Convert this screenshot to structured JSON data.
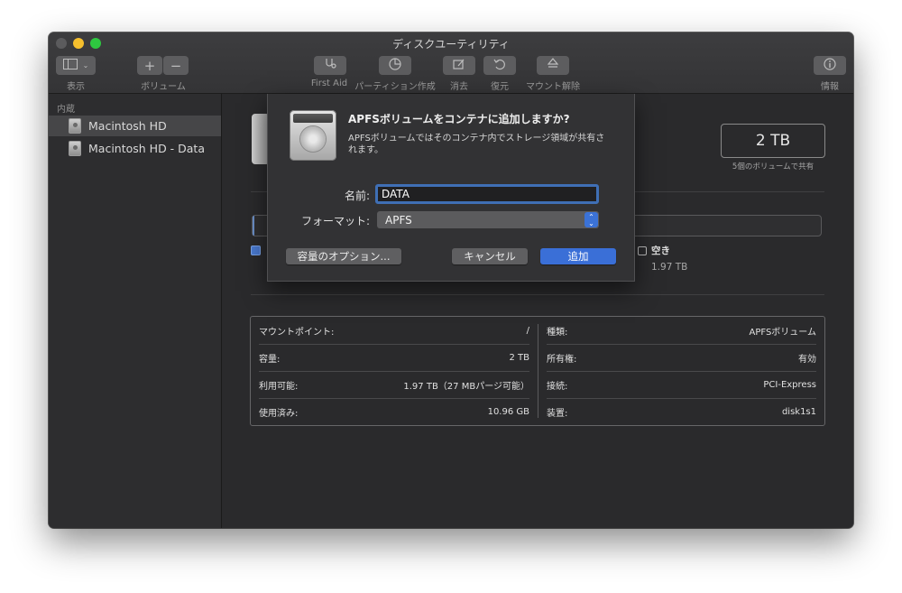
{
  "window": {
    "title": "ディスクユーティリティ"
  },
  "toolbar": {
    "view_label": "表示",
    "volume_label": "ボリューム",
    "first_aid_label": "First Aid",
    "partition_label": "パーティション作成",
    "erase_label": "消去",
    "restore_label": "復元",
    "unmount_label": "マウント解除",
    "info_label": "情報"
  },
  "sidebar": {
    "section": "内蔵",
    "items": [
      {
        "label": "Macintosh HD"
      },
      {
        "label": "Macintosh HD - Data"
      }
    ]
  },
  "main": {
    "capacity": "2 TB",
    "capacity_note": "5個のボリュームで共有",
    "free_label": "空き",
    "free_value": "1.97 TB"
  },
  "info": {
    "left": [
      {
        "label": "マウントポイント:",
        "value": "/"
      },
      {
        "label": "容量:",
        "value": "2 TB"
      },
      {
        "label": "利用可能:",
        "value": "1.97 TB（27 MBパージ可能）"
      },
      {
        "label": "使用済み:",
        "value": "10.96 GB"
      }
    ],
    "right": [
      {
        "label": "種類:",
        "value": "APFSボリューム"
      },
      {
        "label": "所有権:",
        "value": "有効"
      },
      {
        "label": "接続:",
        "value": "PCI-Express"
      },
      {
        "label": "装置:",
        "value": "disk1s1"
      }
    ]
  },
  "dialog": {
    "title": "APFSボリュームをコンテナに追加しますか?",
    "description": "APFSボリュームではそのコンテナ内でストレージ領域が共有されます。",
    "name_label": "名前:",
    "name_value": "DATA",
    "format_label": "フォーマット:",
    "format_value": "APFS",
    "options_button": "容量のオプション...",
    "cancel_button": "キャンセル",
    "add_button": "追加"
  }
}
